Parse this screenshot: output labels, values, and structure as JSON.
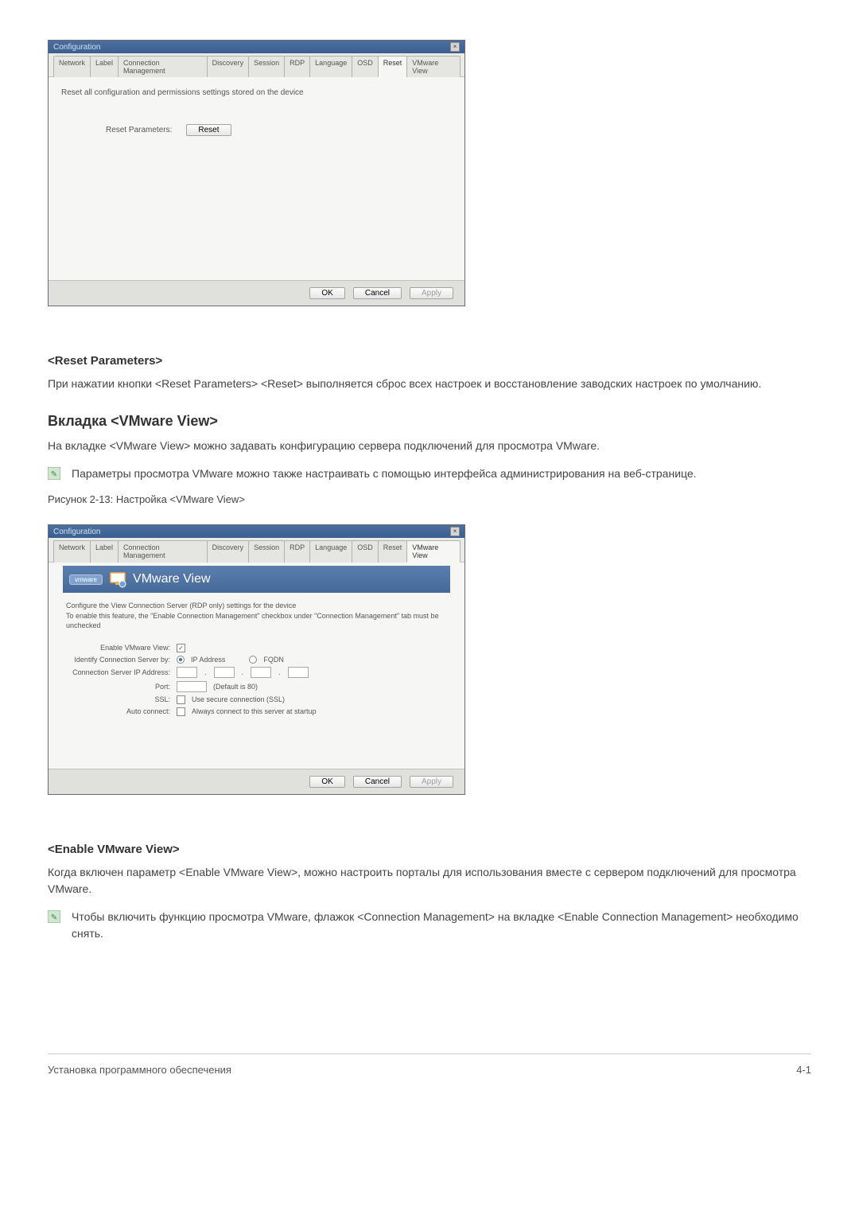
{
  "window1": {
    "title": "Configuration",
    "tabs": [
      "Network",
      "Label",
      "Connection Management",
      "Discovery",
      "Session",
      "RDP",
      "Language",
      "OSD",
      "Reset",
      "VMware View"
    ],
    "active_tab": "Reset",
    "desc": "Reset all configuration and permissions settings stored on the device",
    "reset_label": "Reset Parameters:",
    "reset_btn": "Reset",
    "ok": "OK",
    "cancel": "Cancel",
    "apply": "Apply"
  },
  "section1": {
    "heading": "<Reset Parameters>",
    "para": "При нажатии кнопки <Reset Parameters> <Reset> выполняется сброс всех настроек и восстановление заводских настроек по умолчанию."
  },
  "section2": {
    "heading": "Вкладка <VMware View>",
    "para": "На вкладке <VMware View> можно задавать конфигурацию сервера подключений для просмотра VMware.",
    "note": "Параметры просмотра VMware можно также настраивать с помощью интерфейса администрирования на веб-странице.",
    "figcap": "Рисунок 2-13: Настройка <VMware View>"
  },
  "window2": {
    "title": "Configuration",
    "tabs": [
      "Network",
      "Label",
      "Connection Management",
      "Discovery",
      "Session",
      "RDP",
      "Language",
      "OSD",
      "Reset",
      "VMware View"
    ],
    "active_tab": "VMware View",
    "badge": "vmware",
    "header_title": "VMware View",
    "desc1": "Configure the View Connection Server (RDP only) settings for the device",
    "desc2": "To enable this feature, the \"Enable Connection Management\" checkbox under \"Connection Management\" tab must be unchecked",
    "labels": {
      "enable": "Enable VMware View:",
      "identify": "Identify Connection Server by:",
      "ip_option": "IP Address",
      "fqdn_option": "FQDN",
      "server_ip": "Connection Server IP Address:",
      "port": "Port:",
      "port_default": "(Default is 80)",
      "ssl": "SSL:",
      "ssl_text": "Use secure connection (SSL)",
      "auto": "Auto connect:",
      "auto_text": "Always connect to this server at startup"
    },
    "ok": "OK",
    "cancel": "Cancel",
    "apply": "Apply"
  },
  "section3": {
    "heading": "<Enable VMware View>",
    "para": "Когда включен параметр <Enable VMware View>, можно настроить порталы для использования вместе с сервером подключений для просмотра VMware.",
    "note": "Чтобы включить функцию просмотра VMware, флажок <Connection Management> на вкладке <Enable Connection Management> необходимо снять."
  },
  "footer": {
    "left": "Установка программного обеспечения",
    "right": "4-1"
  }
}
